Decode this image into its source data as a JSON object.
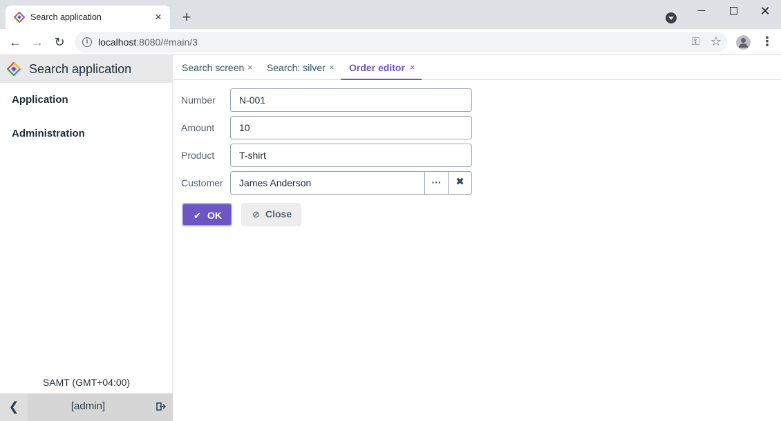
{
  "browser": {
    "tab_title": "Search application",
    "url_host": "localhost",
    "url_rest": ":8080/#main/3",
    "new_tab_label": "+",
    "window_controls": {
      "minimize": "─",
      "close": "✕"
    }
  },
  "app": {
    "title": "Search application",
    "menu": [
      {
        "label": "Application"
      },
      {
        "label": "Administration"
      }
    ],
    "timezone": "SAMT (GMT+04:00)",
    "user": "[admin]",
    "collapse_label": "❮"
  },
  "tabs": [
    {
      "label": "Search screen",
      "close": "×"
    },
    {
      "label": "Search: silver",
      "close": "×"
    },
    {
      "label": "Order editor",
      "close": "×",
      "active": true
    }
  ],
  "form": {
    "number": {
      "label": "Number",
      "value": "N-001"
    },
    "amount": {
      "label": "Amount",
      "value": "10"
    },
    "product": {
      "label": "Product",
      "value": "T-shirt"
    },
    "customer": {
      "label": "Customer",
      "value": "James Anderson",
      "lookup_icon": "···",
      "clear_icon": "✖"
    }
  },
  "buttons": {
    "ok": {
      "label": "OK",
      "icon": "✔"
    },
    "close": {
      "label": "Close",
      "icon": "⊘"
    }
  },
  "colors": {
    "accent": "#6d56c1",
    "sidebar_header": "#e8e8e8",
    "browser_chrome": "#dee1e6"
  }
}
